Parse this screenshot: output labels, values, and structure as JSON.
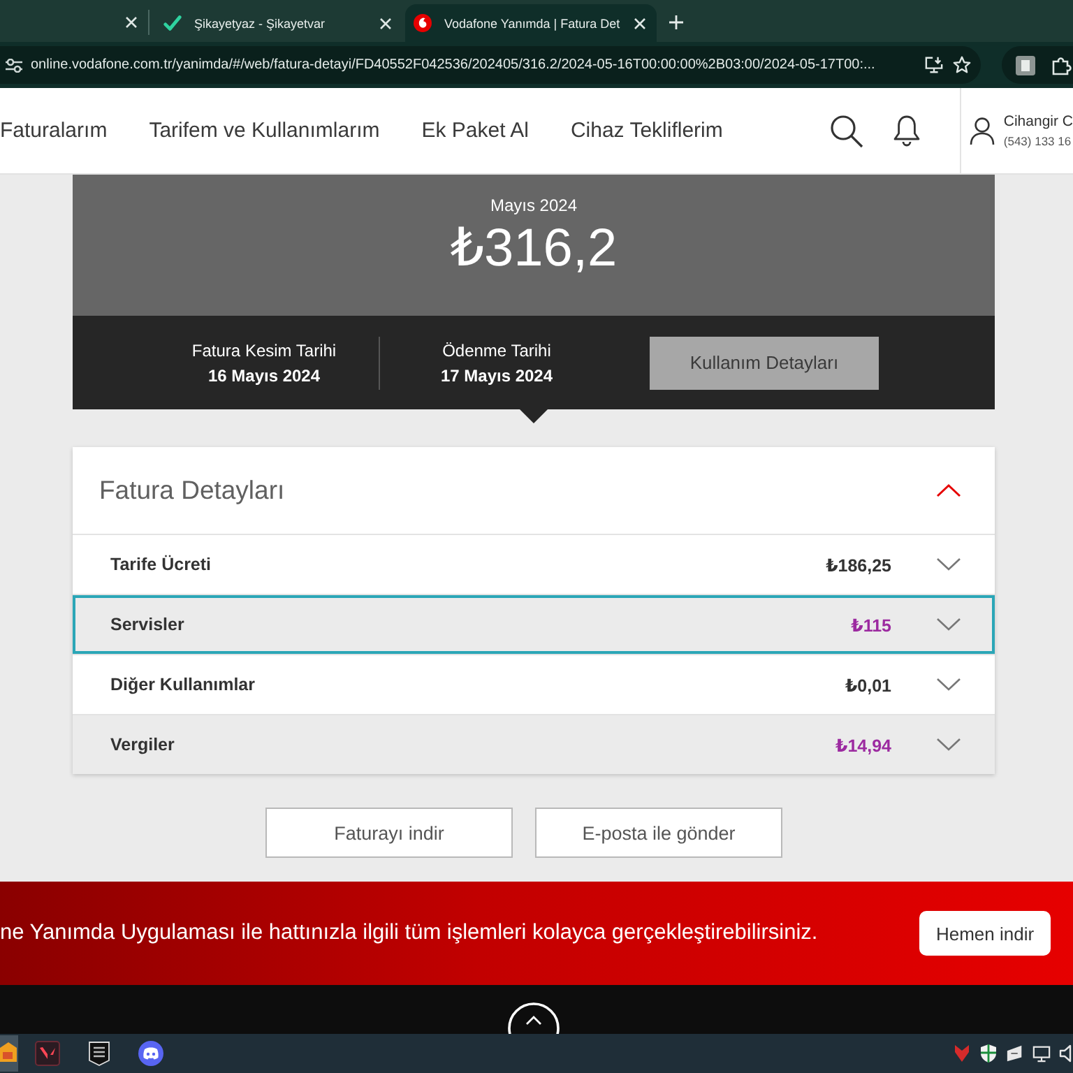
{
  "browser": {
    "tabs": [
      {
        "kind": "partial",
        "selected": false
      },
      {
        "kind": "check",
        "title": "Şikayetyaz - Şikayetvar",
        "selected": false
      },
      {
        "kind": "speech",
        "title": "Vodafone Yanımda | Fatura Det",
        "selected": true
      }
    ],
    "url": "online.vodafone.com.tr/yanimda/#/web/fatura-detayi/FD40552F042536/202405/316.2/2024-05-16T00:00:00%2B03:00/2024-05-17T00:..."
  },
  "nav": {
    "items": [
      "Faturalarım",
      "Tarifem ve Kullanımlarım",
      "Ek Paket Al",
      "Cihaz Tekliflerim"
    ]
  },
  "user": {
    "name": "Cihangir C",
    "phone": "(543) 133 16"
  },
  "bill": {
    "period": "Mayıs 2024",
    "total": "₺316,2",
    "dates": [
      {
        "label": "Fatura Kesim Tarihi",
        "value": "16 Mayıs 2024"
      },
      {
        "label": "Ödenme Tarihi",
        "value": "17 Mayıs 2024"
      }
    ],
    "usage_button": "Kullanım Detayları"
  },
  "details": {
    "title": "Fatura Detayları",
    "expanded": true,
    "rows": [
      {
        "label": "Tarife Ücreti",
        "amount": "₺186,25",
        "highlighted": false,
        "focused": false,
        "expanded": false
      },
      {
        "label": "Servisler",
        "amount": "₺115",
        "highlighted": true,
        "focused": true,
        "expanded": false
      },
      {
        "label": "Diğer Kullanımlar",
        "amount": "₺0,01",
        "highlighted": false,
        "focused": false,
        "expanded": false
      },
      {
        "label": "Vergiler",
        "amount": "₺14,94",
        "highlighted": true,
        "focused": false,
        "expanded": false
      }
    ]
  },
  "actions": {
    "buttons": [
      "Faturayı indir",
      "E-posta ile gönder"
    ]
  },
  "banner": {
    "text": "ne Yanımda Uygulaması ile hattınızla ilgili tüm işlemleri kolayca gerçekleştirebilirsiniz.",
    "button": "Hemen indir"
  }
}
